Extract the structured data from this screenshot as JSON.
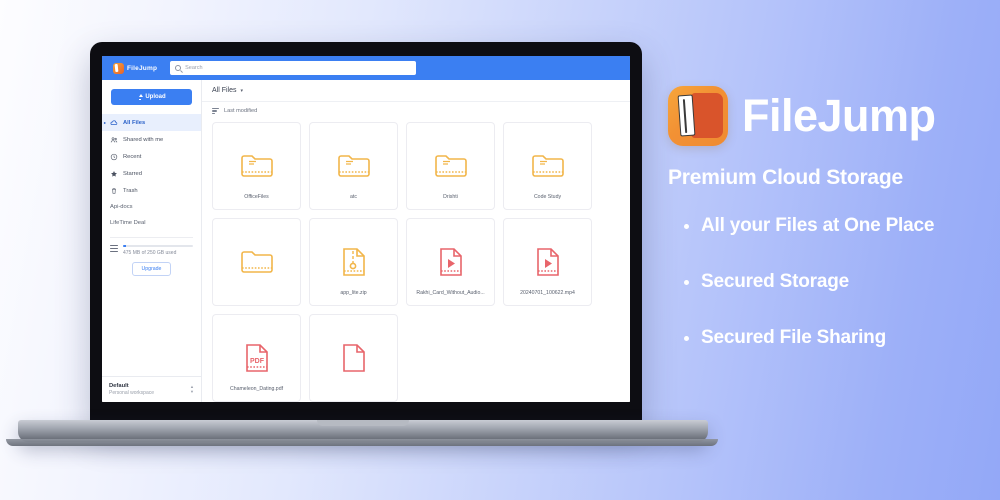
{
  "promo": {
    "brand_name": "FileJump",
    "logo_icon": "filejump-book-logo",
    "tagline": "Premium Cloud Storage",
    "bullets": [
      "All your Files at One Place",
      "Secured Storage",
      "Secured File Sharing"
    ]
  },
  "app": {
    "topbar": {
      "brand": "FileJump",
      "brand_icon": "filejump-logo-icon",
      "search_icon": "search-icon",
      "search_placeholder": "Search",
      "search_value": ""
    },
    "sidebar": {
      "upload_label": "Upload",
      "upload_icon": "upload-icon",
      "items": [
        {
          "label": "All Files",
          "icon": "cloud-icon",
          "active": true
        },
        {
          "label": "Shared with me",
          "icon": "people-icon",
          "active": false
        },
        {
          "label": "Recent",
          "icon": "clock-icon",
          "active": false
        },
        {
          "label": "Starred",
          "icon": "star-icon",
          "active": false
        },
        {
          "label": "Trash",
          "icon": "trash-icon",
          "active": false
        }
      ],
      "plain_links": [
        {
          "label": "Api-docs"
        },
        {
          "label": "LifeTime Deal"
        }
      ],
      "storage": {
        "menu_icon": "hamburger-icon",
        "usage_text": "475 MB of 250 GB used",
        "percent": 4,
        "upgrade_label": "Upgrade"
      },
      "workspace": {
        "name": "Default",
        "subtitle": "Personal workspace",
        "selector_icon": "chevron-updown-icon"
      }
    },
    "main": {
      "breadcrumb": "All Files",
      "breadcrumb_caret_icon": "caret-down-icon",
      "sort_icon": "sort-icon",
      "sort_label": "Last modified",
      "files": [
        {
          "name": "OfficeFiles",
          "type": "folder",
          "color": "#f2b64a"
        },
        {
          "name": "atc",
          "type": "folder",
          "color": "#f2b64a"
        },
        {
          "name": "Drishti",
          "type": "folder",
          "color": "#f2b64a"
        },
        {
          "name": "Code Study",
          "type": "folder",
          "color": "#f2b64a"
        },
        {
          "name": "",
          "type": "folder",
          "color": "#f2b64a"
        },
        {
          "name": "app_lite.zip",
          "type": "zip",
          "color": "#f2b64a"
        },
        {
          "name": "Rakhi_Card_Without_Audio...",
          "type": "video",
          "color": "#e8656b"
        },
        {
          "name": "20240701_100622.mp4",
          "type": "video",
          "color": "#e8656b"
        },
        {
          "name": "Chameleon_Dating.pdf",
          "type": "pdf",
          "color": "#e8656b"
        },
        {
          "name": "",
          "type": "pdf",
          "color": "#e8656b"
        }
      ]
    }
  },
  "colors": {
    "accent_blue": "#3b7ff2",
    "brand_orange": "#ef8b32",
    "folder_yellow": "#f2b64a",
    "file_red": "#e8656b",
    "bg_gradient_start": "#fdfdff",
    "bg_gradient_end": "#93a8f7"
  }
}
